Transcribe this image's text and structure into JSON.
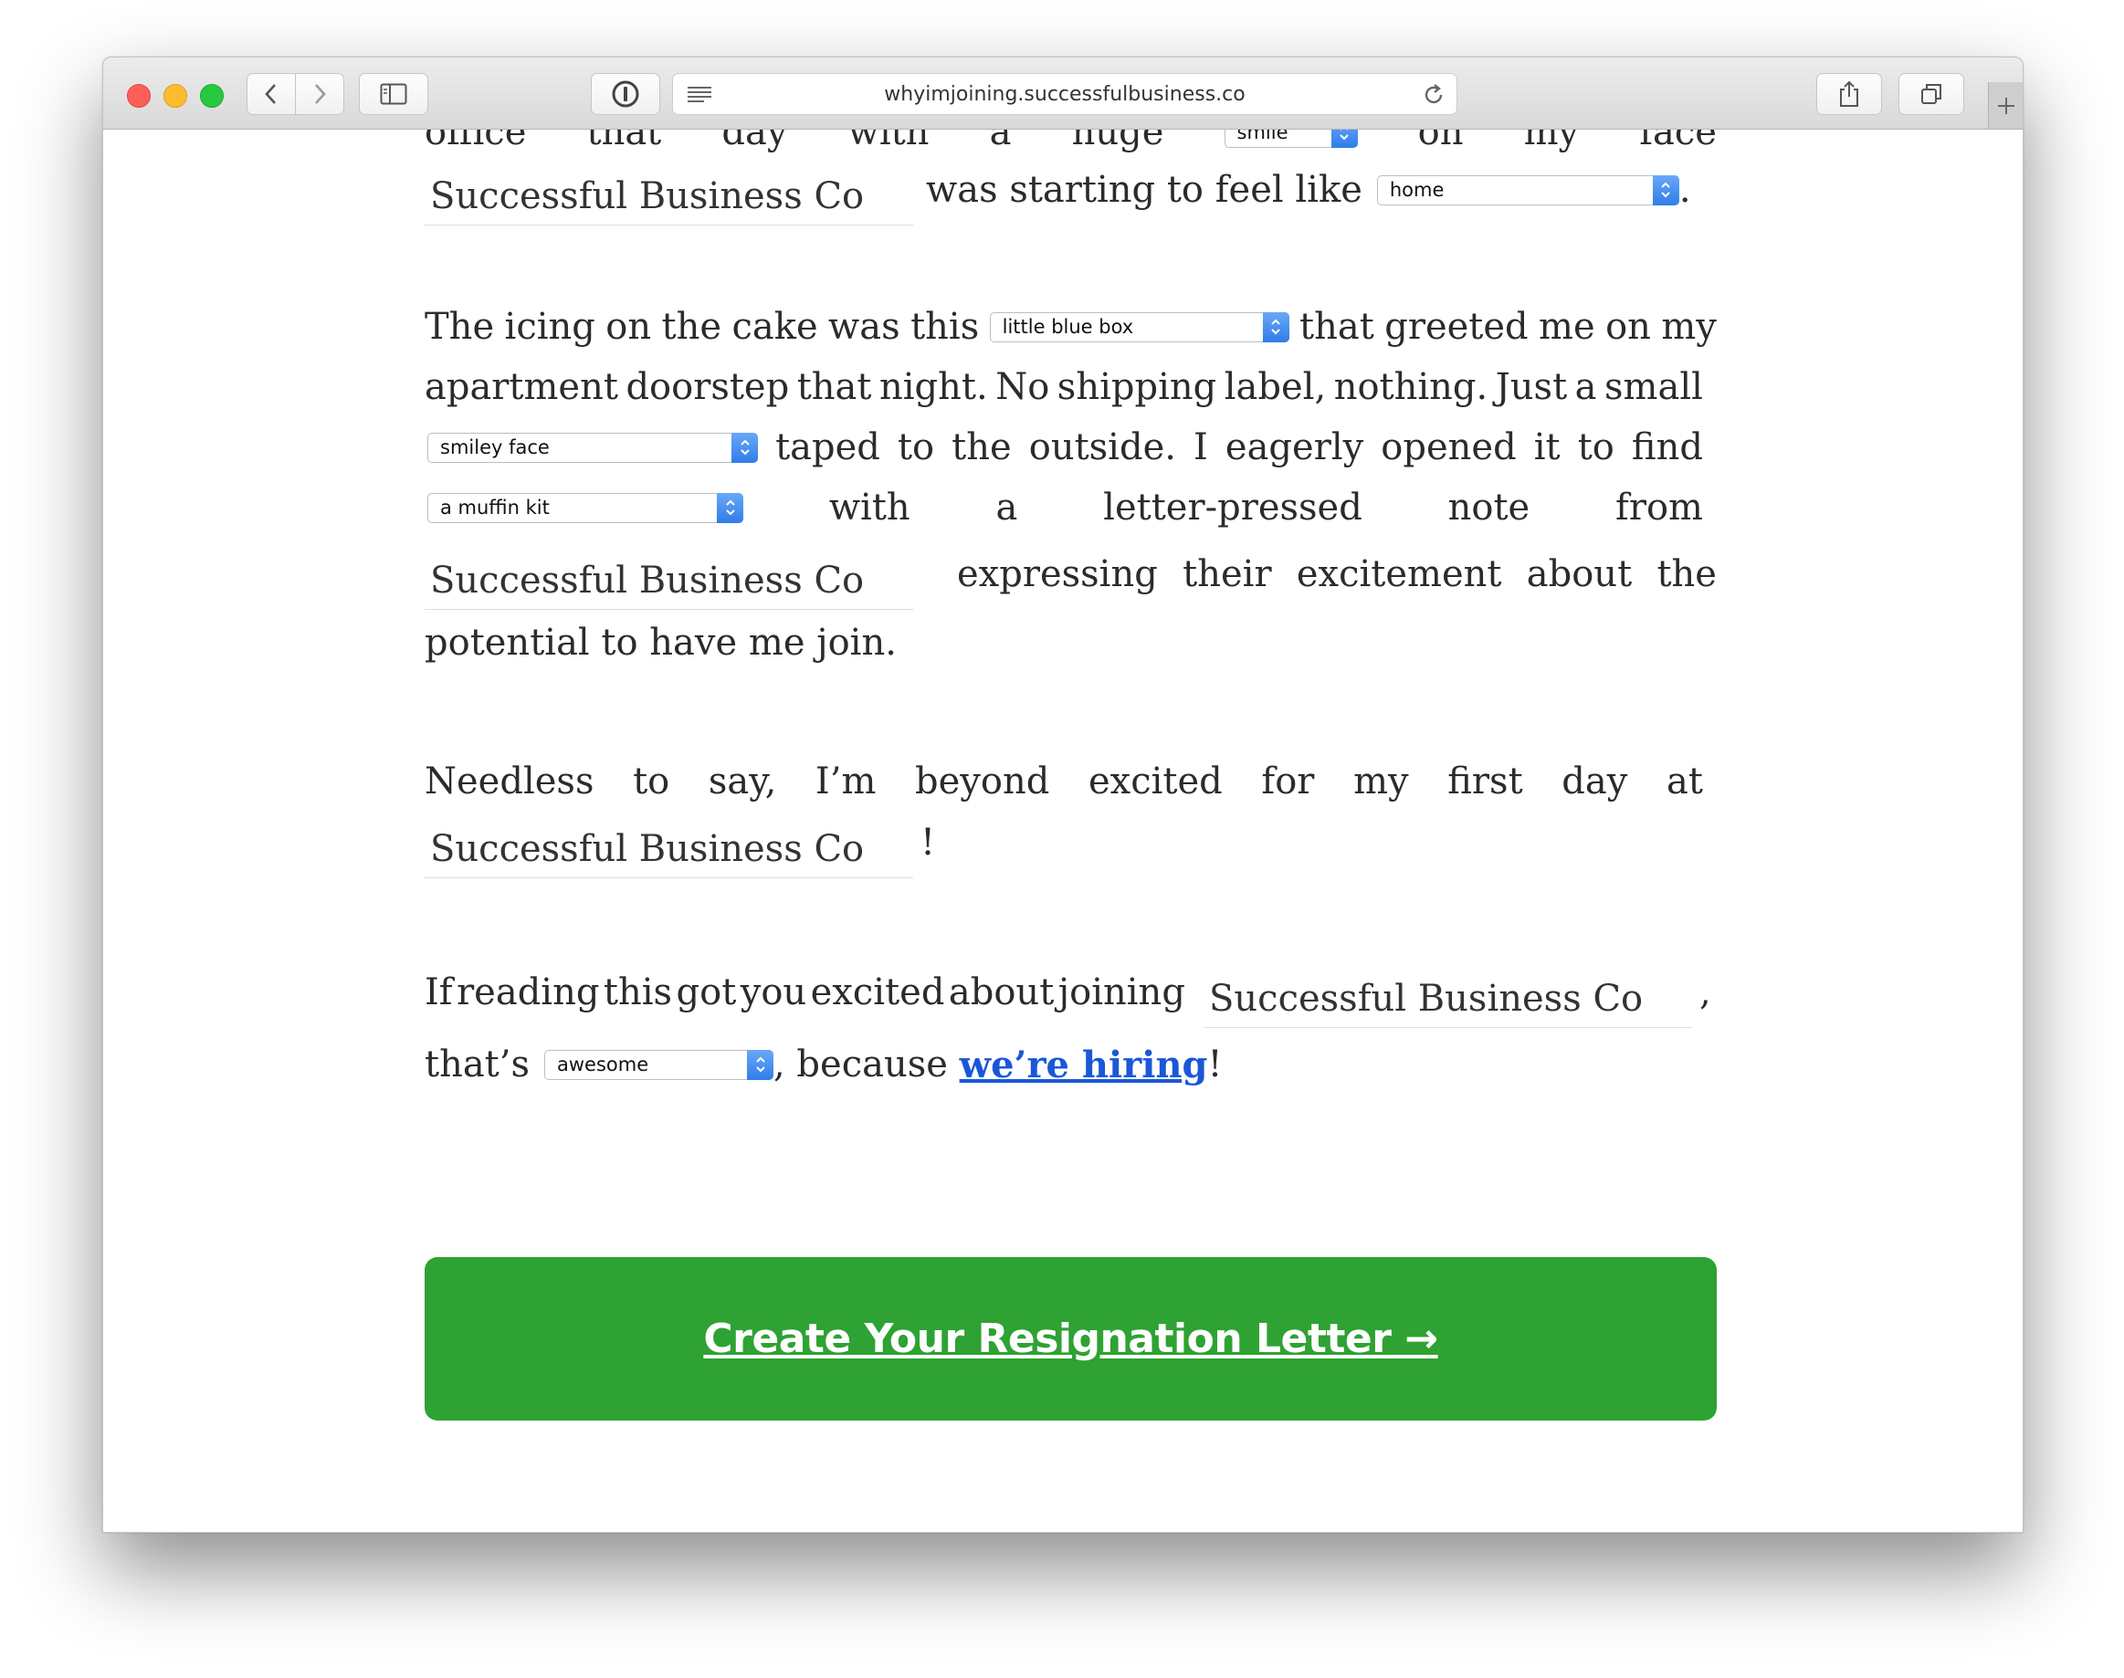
{
  "browser": {
    "url": "whyimjoining.successfulbusiness.co"
  },
  "company_name": "Successful Business Co",
  "paragraph1": {
    "partial_words": [
      "office",
      "that",
      "day",
      "with",
      "a",
      "huge",
      "on",
      "my",
      "face"
    ],
    "partial_select": "smile",
    "middle": "was starting to feel like",
    "select_home": "home",
    "end": "."
  },
  "paragraph2": {
    "line1_start": [
      "The",
      "icing",
      "on",
      "the",
      "cake",
      "was",
      "this"
    ],
    "select_box": "little blue box",
    "line1_end": [
      "that",
      "greeted",
      "me",
      "on",
      "my"
    ],
    "line2": [
      "apartment",
      "doorstep",
      "that",
      "night.",
      "No",
      "shipping",
      "label,",
      "nothing.",
      "Just",
      "a",
      "small"
    ],
    "select_face": "smiley face",
    "line3": [
      "taped",
      "to",
      "the",
      "outside.",
      "I",
      "eagerly",
      "opened",
      "it",
      "to",
      "find"
    ],
    "select_kit": "a muffin kit",
    "line4": [
      "with",
      "a",
      "letter-pressed",
      "note",
      "from"
    ],
    "line5": [
      "expressing",
      "their",
      "excitement",
      "about",
      "the"
    ],
    "line6": "potential to have me join."
  },
  "paragraph3": {
    "line1": [
      "Needless",
      "to",
      "say,",
      "I’m",
      "beyond",
      "excited",
      "for",
      "my",
      "first",
      "day",
      "at"
    ],
    "end": "!"
  },
  "paragraph4": {
    "line1_start": [
      "If",
      "reading",
      "this",
      "got",
      "you",
      "excited",
      "about",
      "joining"
    ],
    "comma": ",",
    "thats": "that’s",
    "select_awesome": "awesome",
    "because": ", because ",
    "link": "we’re hiring",
    "end": "!"
  },
  "cta": {
    "label": "Create Your Resignation Letter →"
  }
}
